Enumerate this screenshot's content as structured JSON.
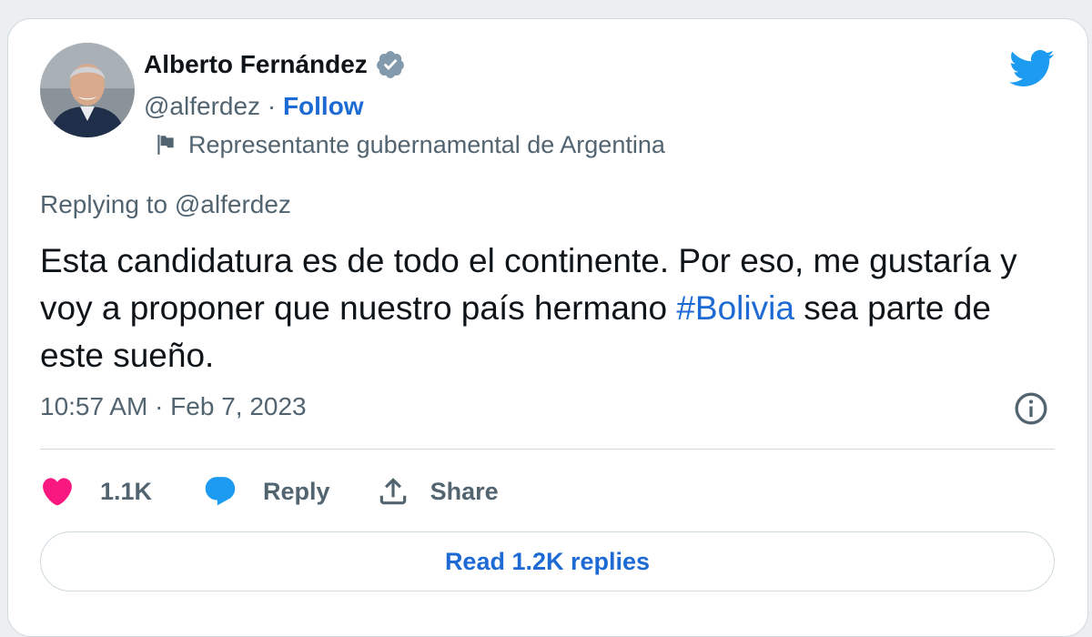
{
  "author": {
    "name": "Alberto Fernández",
    "handle": "@alferdez",
    "separator": " · ",
    "follow_label": "Follow",
    "label": "Representante gubernamental de Argentina",
    "avatar_icon": "person-photo-avatar",
    "verified_icon": "verified-badge-icon",
    "flag_icon": "flag-icon"
  },
  "brand": {
    "icon": "twitter-bird-icon",
    "color": "#1d9bf0"
  },
  "tweet": {
    "replying_prefix": "Replying to ",
    "replying_to": "@alferdez",
    "text_part1": "Esta candidatura es de todo el continente. Por eso, me gustaría y voy a proponer que nuestro país hermano ",
    "hashtag": "#Bolivia",
    "text_part2": " sea parte de este sueño.",
    "timestamp": "10:57 AM · Feb 7, 2023",
    "info_icon": "info-icon"
  },
  "actions": {
    "like_count": "1.1K",
    "reply_label": "Reply",
    "share_label": "Share",
    "like_color": "#f91880",
    "reply_color": "#1d9bf0"
  },
  "footer": {
    "read_replies_label": "Read 1.2K replies"
  }
}
